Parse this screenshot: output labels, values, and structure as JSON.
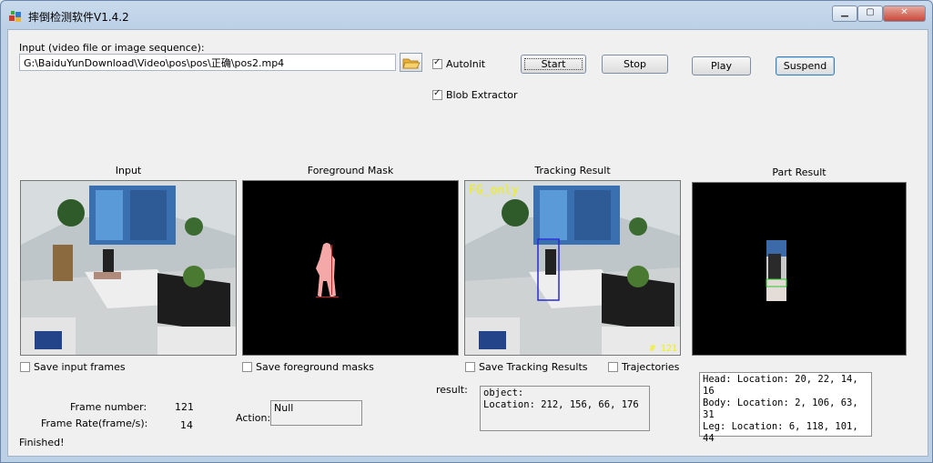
{
  "window": {
    "title": "摔倒检测软件V1.4.2",
    "controls": {
      "minimize": "▁",
      "maximize": "▢",
      "close": "✕"
    }
  },
  "input_section": {
    "label": "Input (video file or image sequence):",
    "path_value": "G:\\BaiduYunDownload\\Video\\pos\\pos\\正确\\pos2.mp4",
    "browse_icon": "folder-open-icon"
  },
  "options": {
    "autoinit_label": "AutoInit",
    "autoinit_checked": true,
    "blob_label": "Blob Extractor",
    "blob_checked": true
  },
  "buttons": {
    "start": "Start",
    "stop": "Stop",
    "play": "Play",
    "suspend": "Suspend"
  },
  "panels": {
    "input": "Input",
    "foreground": "Foreground Mask",
    "tracking": "Tracking Result",
    "part": "Part Result",
    "tracking_overlay_tl": "FG_only",
    "tracking_overlay_br": "# 121"
  },
  "save_options": {
    "save_input": "Save input frames",
    "save_fg": "Save foreground masks",
    "save_tracking": "Save Tracking Results",
    "trajectories": "Trajectories"
  },
  "stats": {
    "frame_number_label": "Frame number:",
    "frame_number_value": "121",
    "frame_rate_label": "Frame Rate(frame/s):",
    "frame_rate_value": "14",
    "action_label": "Action:",
    "action_value": "Null",
    "result_label": "result:",
    "result_line1": "object:",
    "result_line2": "Location: 212, 156, 66, 176",
    "part_head": "Head: Location: 20, 22, 14, 16",
    "part_body": "Body: Location: 2, 106, 63, 31",
    "part_leg": "Leg: Location: 6, 118, 101, 44",
    "status": "Finished!"
  },
  "colors": {
    "overlay_yellow": "#f2f200",
    "tracking_box": "#2a2ad8",
    "part_box": "#2ecc2e",
    "mask_pink": "#f4a8a8"
  }
}
